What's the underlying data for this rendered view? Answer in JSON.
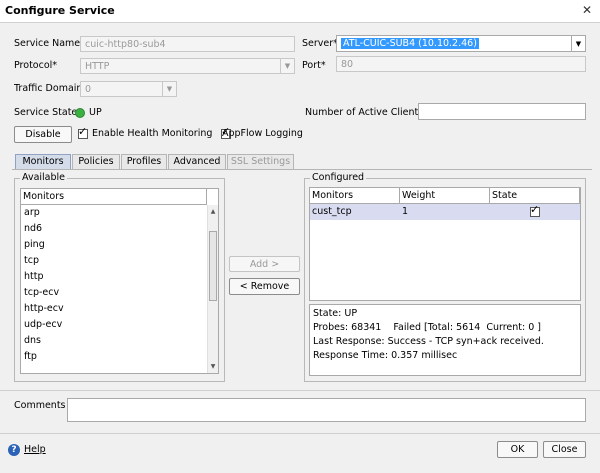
{
  "window": {
    "title": "Configure Service",
    "close_icon": "✕"
  },
  "form": {
    "service_name_label": "Service Name*",
    "service_name_value": "cuic-http80-sub4",
    "server_label": "Server*",
    "server_value": "ATL-CUIC-SUB4 (10.10.2.46)",
    "protocol_label": "Protocol*",
    "protocol_value": "HTTP",
    "port_label": "Port*",
    "port_value": "80",
    "traffic_domain_label": "Traffic Domain",
    "traffic_domain_value": "0",
    "service_state_label": "Service State",
    "service_state_value": "UP",
    "status_color": "#3cb043",
    "active_clients_label": "Number of Active Clients",
    "active_clients_value": ""
  },
  "controls": {
    "disable_label": "Disable",
    "enable_health_label": "Enable Health Monitoring",
    "appflow_label": "AppFlow Logging"
  },
  "tabs": [
    "Monitors",
    "Policies",
    "Profiles",
    "Advanced",
    "SSL Settings"
  ],
  "available": {
    "legend": "Available",
    "header": "Monitors",
    "items": [
      "arp",
      "nd6",
      "ping",
      "tcp",
      "http",
      "tcp-ecv",
      "http-ecv",
      "udp-ecv",
      "dns",
      "ftp"
    ]
  },
  "transfer": {
    "add_label": "Add >",
    "remove_label": "< Remove"
  },
  "configured": {
    "legend": "Configured",
    "headers": [
      "Monitors",
      "Weight",
      "State"
    ],
    "rows": [
      {
        "monitor": "cust_tcp",
        "weight": "1",
        "state_checked": true
      }
    ],
    "details": [
      "State: UP",
      "Probes: 68341    Failed [Total: 5614  Current: 0 ]",
      "Last Response: Success - TCP syn+ack received.",
      "Response Time: 0.357 millisec"
    ]
  },
  "comments": {
    "label": "Comments",
    "value": ""
  },
  "footer": {
    "help_label": "Help",
    "ok_label": "OK",
    "close_label": "Close",
    "help_icon_color": "#2a62b8"
  }
}
